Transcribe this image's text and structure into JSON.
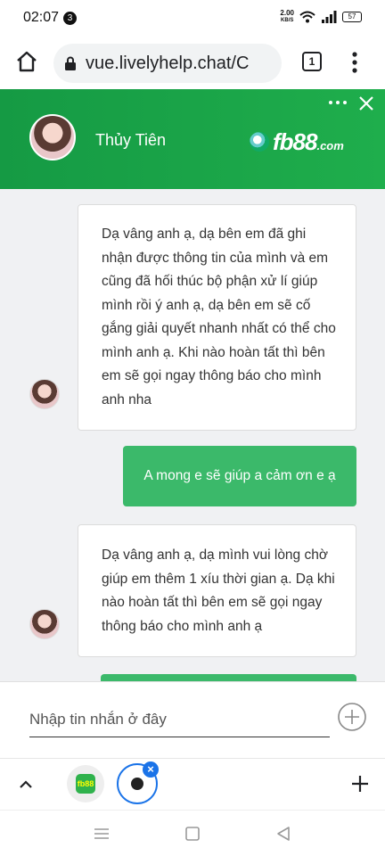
{
  "status_bar": {
    "time": "02:07",
    "notification_count": "3",
    "net_speed_value": "2.00",
    "net_speed_unit": "KB/S",
    "battery": "57"
  },
  "browser": {
    "url": "vue.livelyhelp.chat/C",
    "tab_count": "1"
  },
  "chat_header": {
    "agent_name": "Thủy Tiên",
    "brand_main": "fb88",
    "brand_suffix": ".com"
  },
  "messages": [
    {
      "direction": "incoming",
      "text": "Dạ vâng anh ạ, dạ bên em đã ghi nhận được thông tin của mình và em cũng đã hối thúc bộ phận xử lí giúp mình rồi ý anh ạ, dạ bên em sẽ cố gắng giải quyết nhanh nhất có thể cho mình anh ạ. Khi nào hoàn tất thì bên em sẽ gọi ngay thông báo cho mình anh nha"
    },
    {
      "direction": "outgoing",
      "text": "A mong e sẽ giúp a cảm ơn e ạ"
    },
    {
      "direction": "incoming",
      "text": "Dạ vâng anh ạ, dạ mình vui lòng chờ giúp em thêm 1 xíu thời gian ạ. Dạ khi nào hoàn tất thì bên em sẽ gọi ngay thông báo cho mình anh ạ"
    }
  ],
  "composer": {
    "placeholder": "Nhập tin nhắn ở đây",
    "value": ""
  },
  "colors": {
    "header_green": "#1fae4c",
    "outgoing_bubble": "#3bb96a",
    "active_tab_ring": "#1a73e8"
  }
}
